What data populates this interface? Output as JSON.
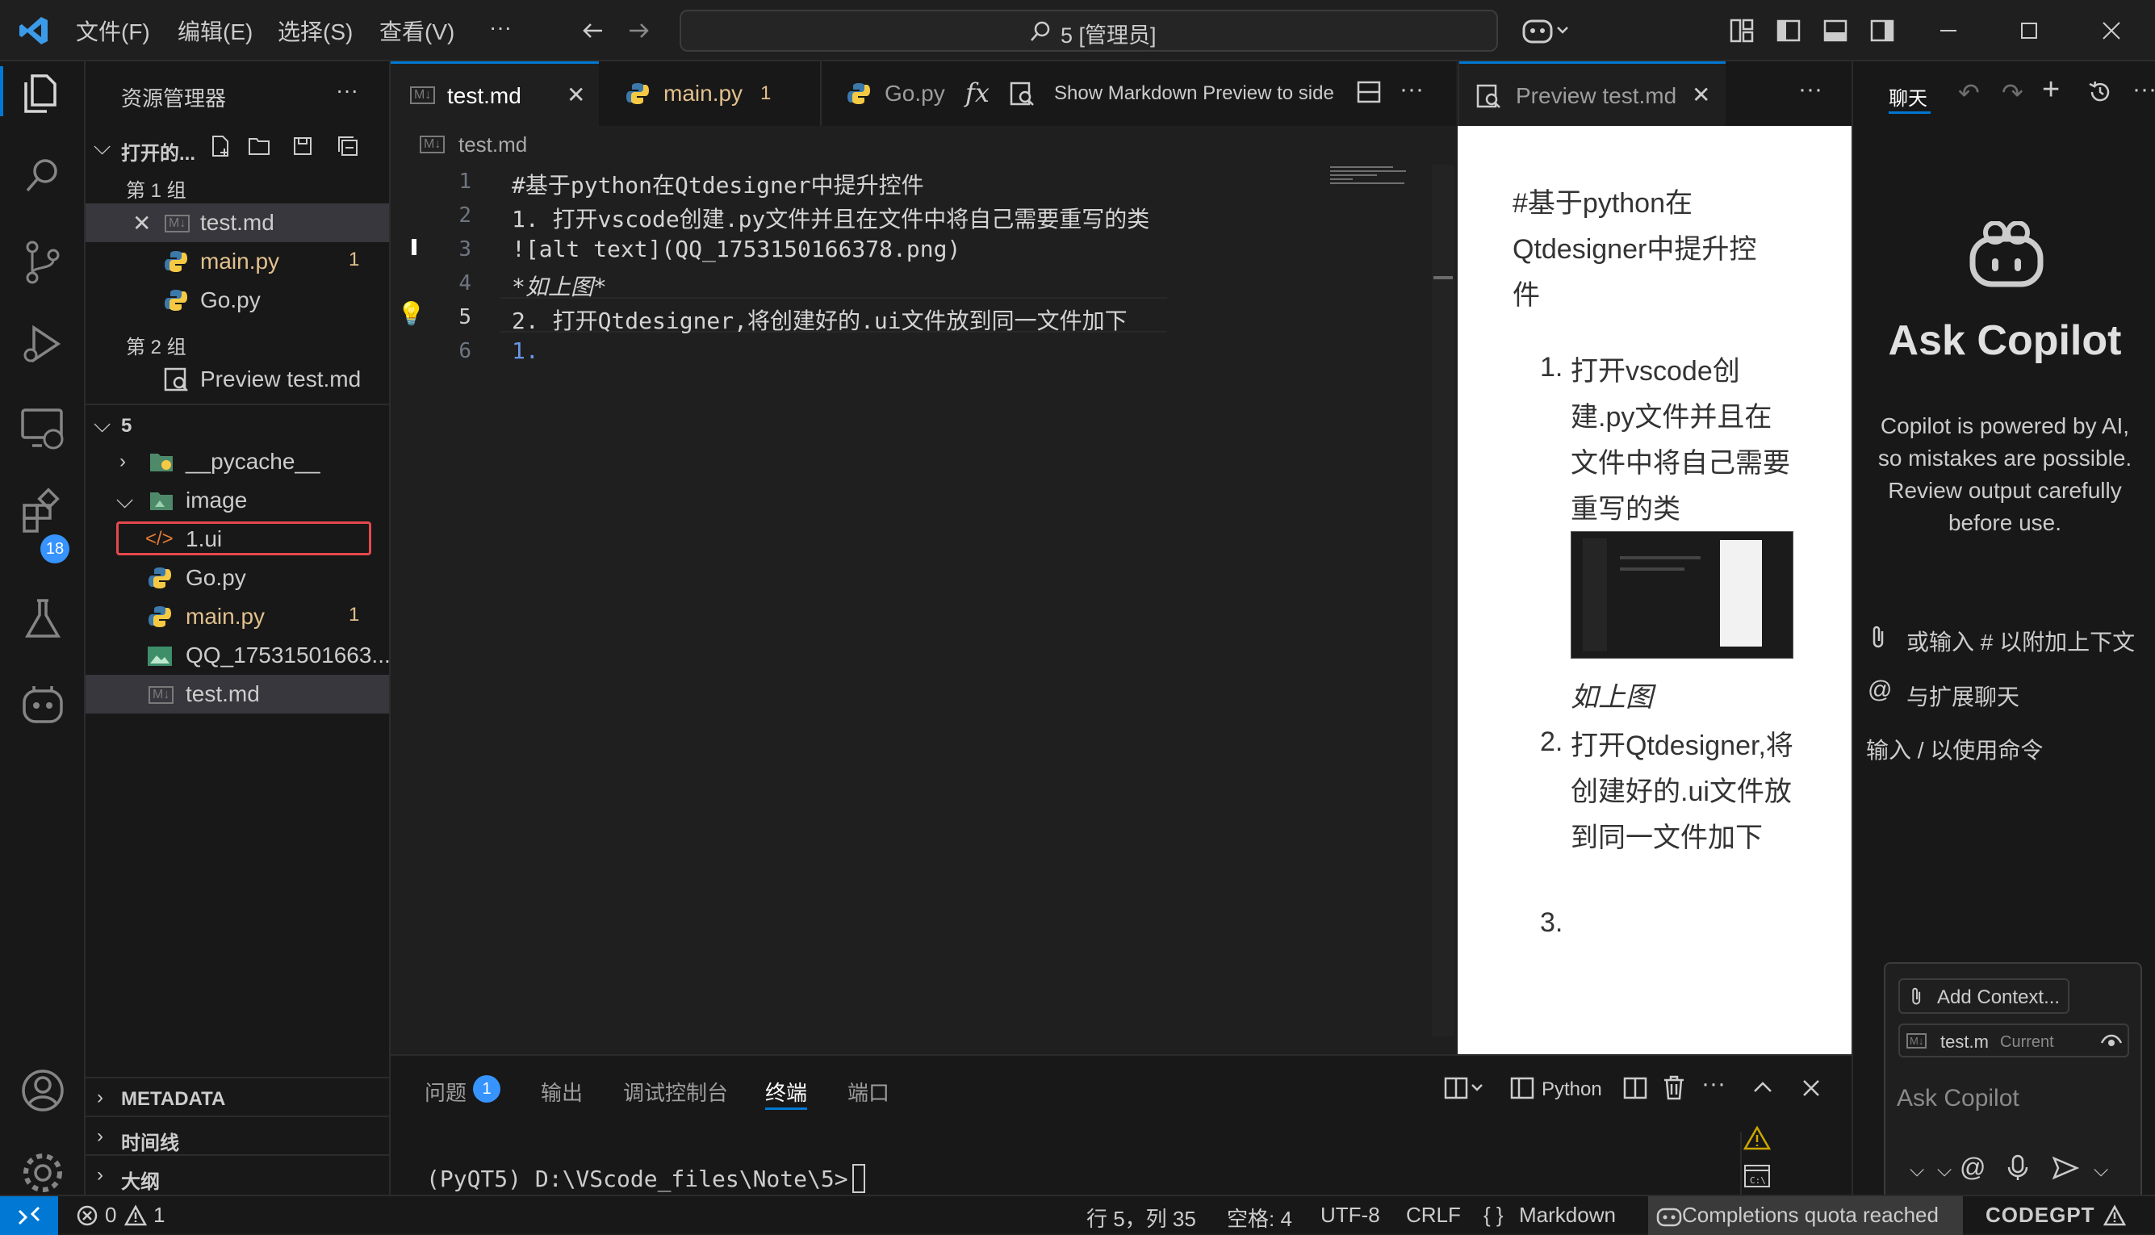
{
  "titlebar": {
    "menus": [
      "文件(F)",
      "编辑(E)",
      "选择(S)",
      "查看(V)",
      "···"
    ],
    "search_text": "5 [管理员]"
  },
  "activity": {
    "extensions_badge": "18"
  },
  "explorer": {
    "title": "资源管理器",
    "open_editors": "打开的...",
    "group1": "第 1 组",
    "group1_items": [
      {
        "name": "test.md",
        "badge": ""
      },
      {
        "name": "main.py",
        "badge": "1"
      },
      {
        "name": "Go.py",
        "badge": ""
      }
    ],
    "group2": "第 2 组",
    "group2_items": [
      {
        "name": "Preview test.md"
      }
    ],
    "folder": "5",
    "tree": [
      {
        "name": "__pycache__",
        "badge": ""
      },
      {
        "name": "image",
        "badge": ""
      },
      {
        "name": "1.ui",
        "badge": ""
      },
      {
        "name": "Go.py",
        "badge": ""
      },
      {
        "name": "main.py",
        "badge": "1"
      },
      {
        "name": "QQ_17531501663...",
        "badge": ""
      },
      {
        "name": "test.md",
        "badge": ""
      }
    ],
    "sections": [
      "METADATA",
      "时间线",
      "大纲"
    ]
  },
  "tabs": {
    "items": [
      {
        "label": "test.md",
        "badge": ""
      },
      {
        "label": "main.py",
        "badge": "1"
      },
      {
        "label": "Go.py",
        "badge": ""
      }
    ],
    "action_label": "Show Markdown Preview to side"
  },
  "editor": {
    "breadcrumb": "test.md",
    "lines": [
      {
        "num": "1",
        "text": "#基于python在Qtdesigner中提升控件"
      },
      {
        "num": "2",
        "text": "1. 打开vscode创建.py文件并且在文件中将自己需要重写的类"
      },
      {
        "num": "3",
        "text": "![alt text](QQ_1753150166378.png)"
      },
      {
        "num": "4",
        "text": "*如上图*"
      },
      {
        "num": "5",
        "text": "2. 打开Qtdesigner,将创建好的.ui文件放到同一文件加下"
      },
      {
        "num": "6",
        "text": "1."
      }
    ]
  },
  "preview": {
    "tab_label": "Preview test.md",
    "heading": "#基于python在Qtdesigner中提升控件",
    "item1": "打开vscode创建.py文件并且在文件中将自己需要重写的类",
    "caption": "如上图",
    "item2": "打开Qtdesigner,将创建好的.ui文件放到同一文件加下",
    "n1": "1.",
    "n2": "2.",
    "n3": "3."
  },
  "copilot": {
    "tab": "聊天",
    "title": "Ask Copilot",
    "disclaimer": "Copilot is powered by AI, so mistakes are possible. Review output carefully before use.",
    "hint1": "或输入 # 以附加上下文",
    "hint2": "与扩展聊天",
    "hint3": "输入 / 以使用命令",
    "add_context": "Add Context...",
    "file_chip": "test.m",
    "file_chip_tag": "Current",
    "input_placeholder": "Ask Copilot"
  },
  "panel": {
    "tabs": [
      "问题",
      "输出",
      "调试控制台",
      "终端",
      "端口"
    ],
    "problems_badge": "1",
    "terminal_kind": "Python",
    "terminal_line": "(PyQT5) D:\\VScode_files\\Note\\5>"
  },
  "status": {
    "errors": "0",
    "warnings": "1",
    "position": "行 5，列 35",
    "spaces": "空格: 4",
    "encoding": "UTF-8",
    "eol": "CRLF",
    "language": "Markdown",
    "quota": "Completions quota reached",
    "codegpt": "CODEGPT"
  },
  "colors": {
    "accent": "#0078d4",
    "selected_row": "#37373d",
    "highlight_box": "#e5484d",
    "python_file": "#e2c08d",
    "badge": "#3794ff"
  }
}
